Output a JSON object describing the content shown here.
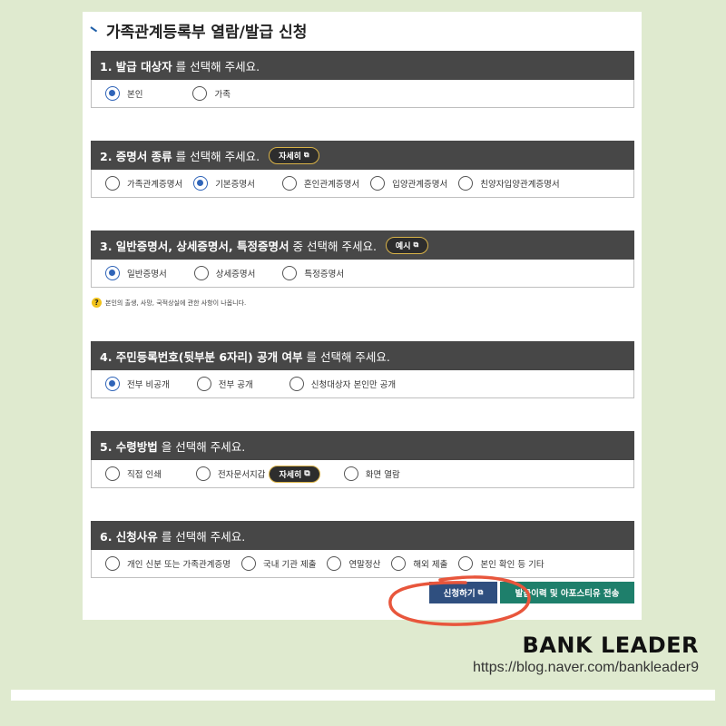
{
  "page": {
    "title": "가족관계등록부 열람/발급 신청"
  },
  "sections": [
    {
      "num": "1. 발급 대상자",
      "text": "를 선택해 주세요.",
      "options": [
        {
          "label": "본인",
          "selected": true
        },
        {
          "label": "가족",
          "selected": false
        }
      ]
    },
    {
      "num": "2. 증명서 종류",
      "text": "를 선택해 주세요.",
      "pill": "자세히",
      "options": [
        {
          "label": "가족관계증명서",
          "selected": false
        },
        {
          "label": "기본증명서",
          "selected": true
        },
        {
          "label": "혼인관계증명서",
          "selected": false
        },
        {
          "label": "입양관계증명서",
          "selected": false
        },
        {
          "label": "친양자입양관계증명서",
          "selected": false
        }
      ]
    },
    {
      "num": "3. 일반증명서, 상세증명서, 특정증명서",
      "text": "중 선택해 주세요.",
      "pill": "예시",
      "options": [
        {
          "label": "일반증명서",
          "selected": true
        },
        {
          "label": "상세증명서",
          "selected": false
        },
        {
          "label": "특정증명서",
          "selected": false
        }
      ],
      "note": "본인의 출생, 사망, 국적상실에 관한 사항이 나옵니다."
    },
    {
      "num": "4. 주민등록번호(뒷부분 6자리) 공개 여부",
      "text": "를 선택해 주세요.",
      "options": [
        {
          "label": "전부 비공개",
          "selected": true
        },
        {
          "label": "전부 공개",
          "selected": false
        },
        {
          "label": "신청대상자 본인만 공개",
          "selected": false
        }
      ]
    },
    {
      "num": "5. 수령방법",
      "text": "을 선택해 주세요.",
      "options": [
        {
          "label": "직접 인쇄",
          "selected": false
        },
        {
          "label": "전자문서지갑",
          "selected": false,
          "pill": "자세히"
        },
        {
          "label": "화면 열람",
          "selected": false
        }
      ]
    },
    {
      "num": "6. 신청사유",
      "text": "를 선택해 주세요.",
      "options": [
        {
          "label": "개인 신분 또는 가족관계증명",
          "selected": false
        },
        {
          "label": "국내 기관 제출",
          "selected": false
        },
        {
          "label": "연말정산",
          "selected": false
        },
        {
          "label": "해외 제출",
          "selected": false
        },
        {
          "label": "본인 확인 등 기타",
          "selected": false
        }
      ]
    }
  ],
  "buttons": {
    "apply": "신청하기",
    "send": "발급이력 및 아포스티유 전송"
  },
  "icons": {
    "external": "external-link-icon",
    "help": "help-icon"
  },
  "colors": {
    "header_bg": "#474747",
    "radio_selected": "#2f64b8",
    "pill_border": "#d9b348",
    "apply_btn": "#2f4f7f",
    "send_btn": "#1e7f6b",
    "highlight_circle": "#e8563c",
    "page_bg": "#dfeacf"
  },
  "watermark": {
    "brand": "BANK LEADER",
    "url": "https://blog.naver.com/bankleader9"
  }
}
